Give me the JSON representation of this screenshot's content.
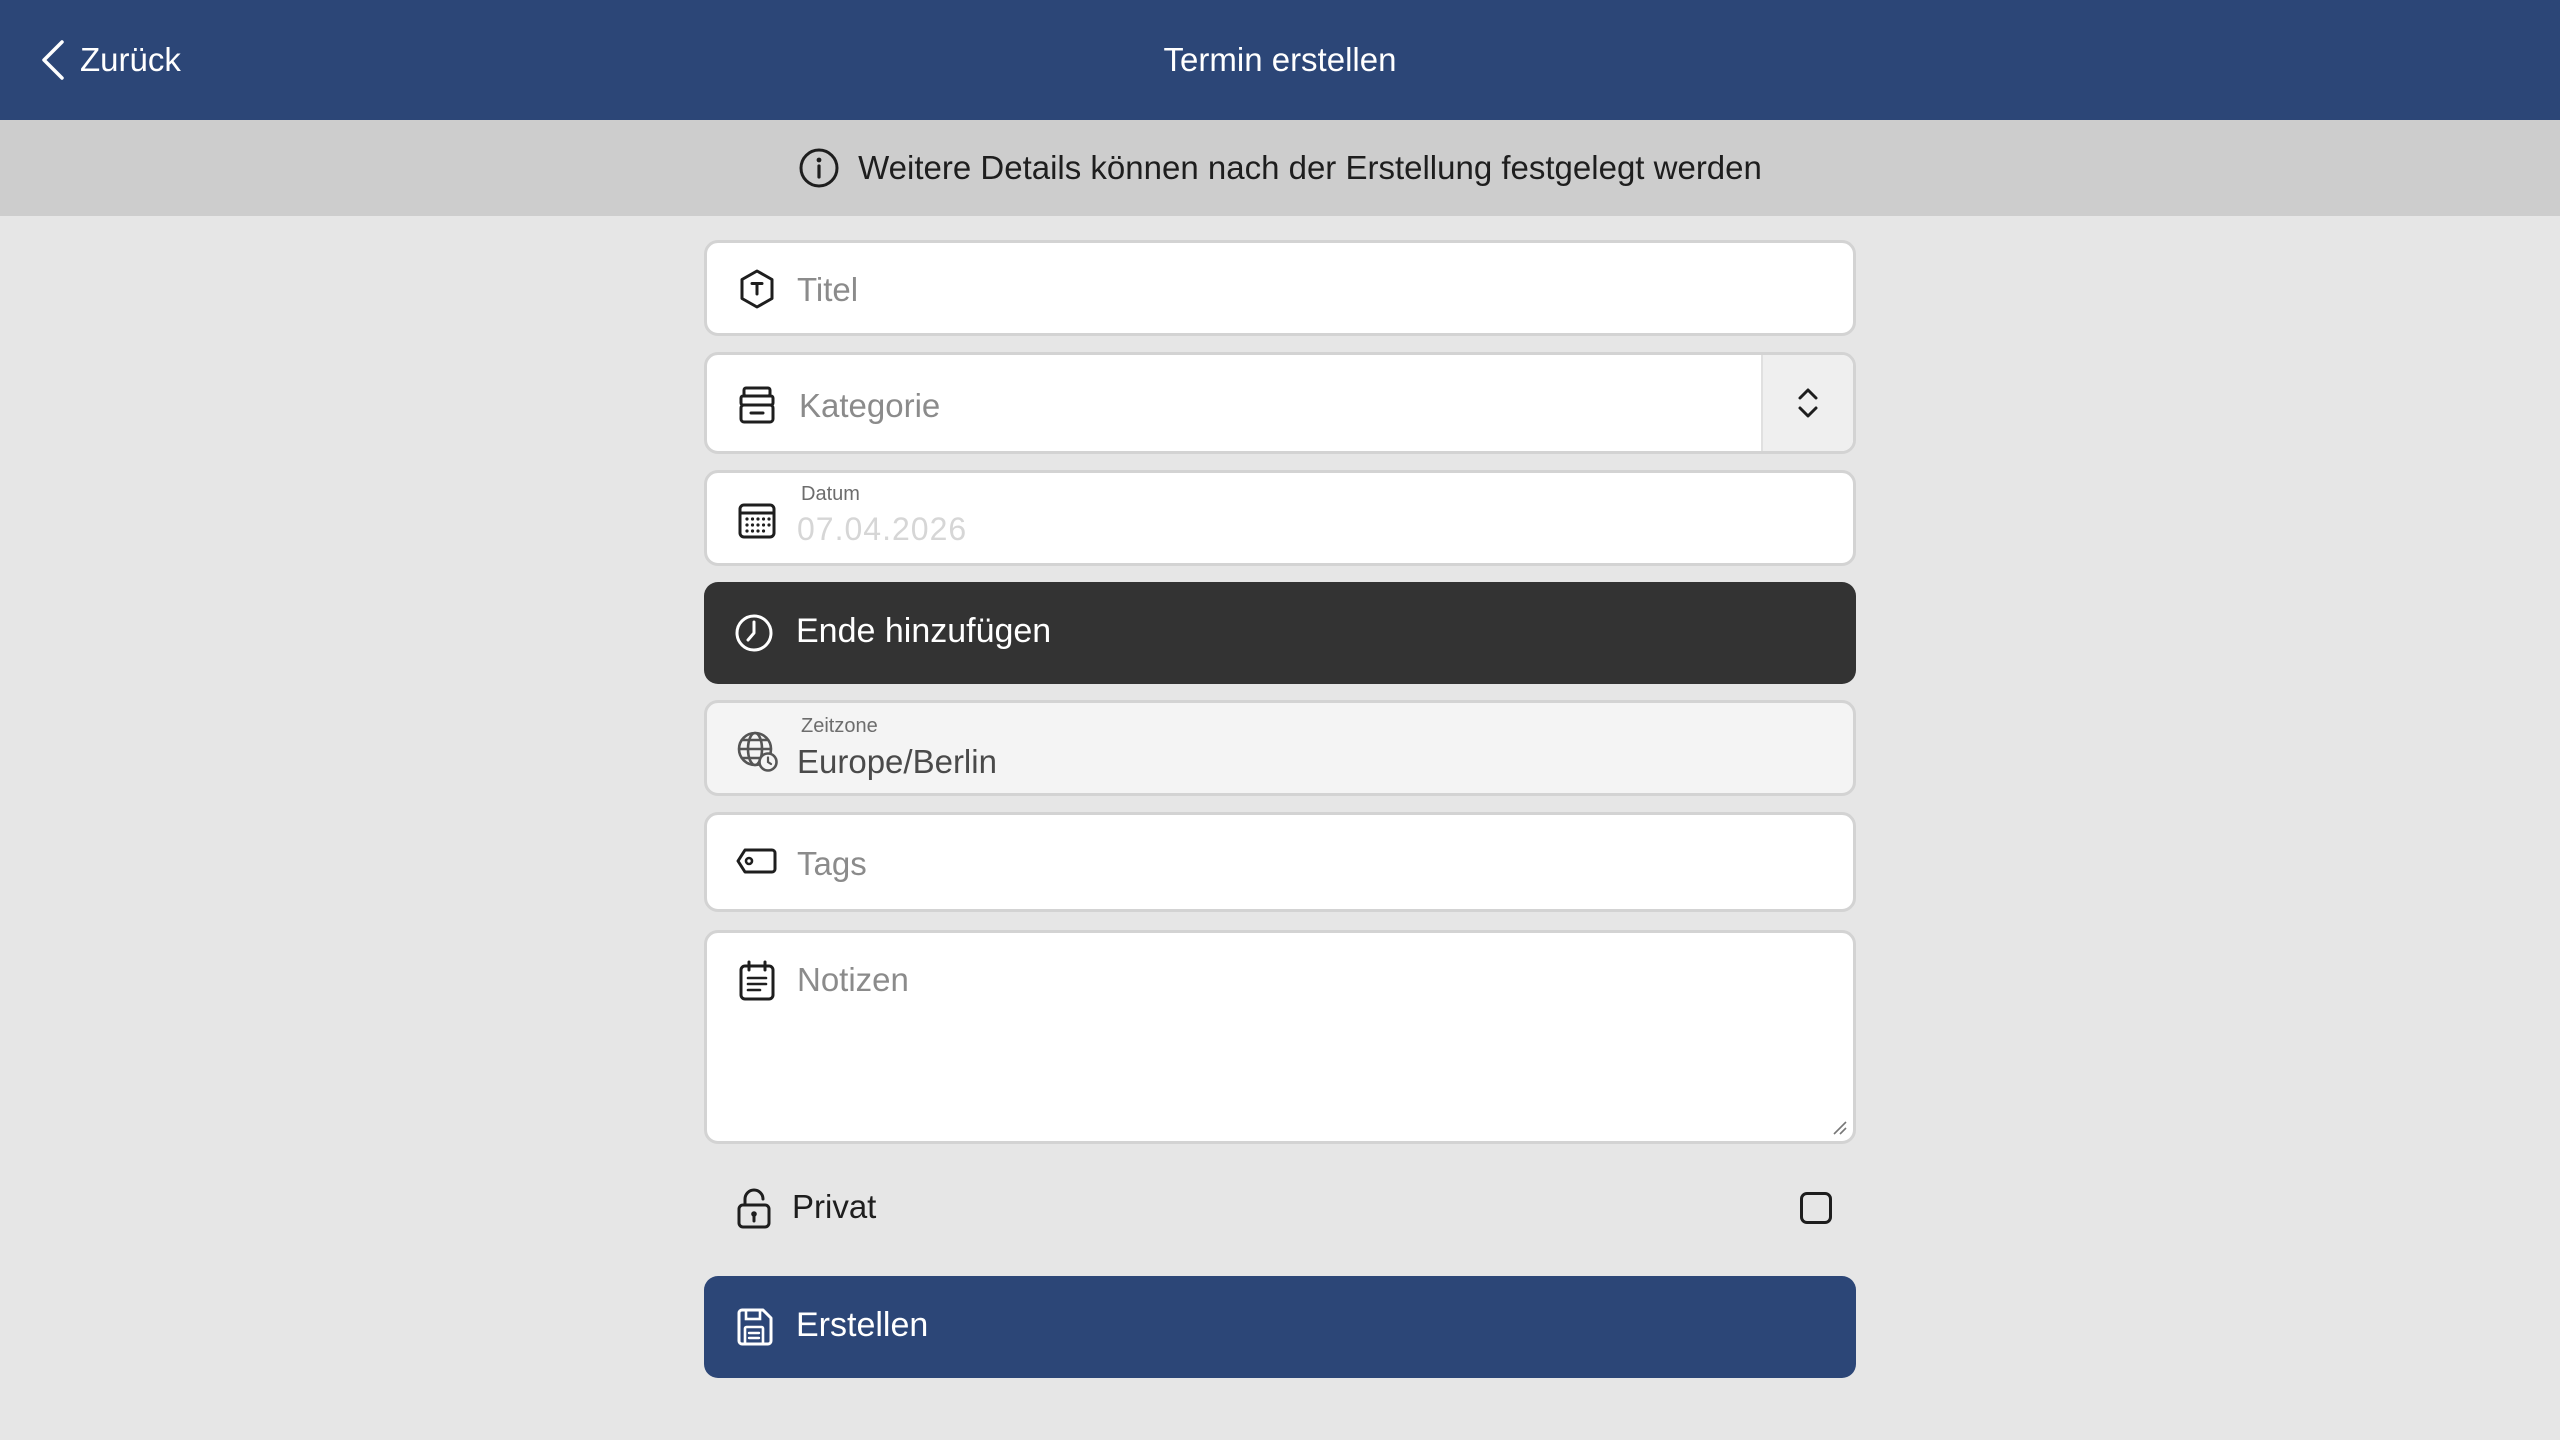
{
  "header": {
    "back_label": "Zurück",
    "title": "Termin erstellen",
    "background": "#2c4677"
  },
  "info": {
    "text": "Weitere Details können nach der Erstellung festgelegt werden",
    "icon": "info-icon"
  },
  "form": {
    "title": {
      "placeholder": "Titel",
      "icon": "title-tag-icon"
    },
    "category": {
      "placeholder": "Kategorie",
      "icon": "archive-box-icon",
      "stepper_icon": "chevron-up-down-icon"
    },
    "date": {
      "label": "Datum",
      "value": "07.04.2026",
      "icon": "calendar-icon"
    },
    "add_end": {
      "label": "Ende hinzufügen",
      "icon": "clock-icon",
      "background": "#333333"
    },
    "timezone": {
      "label": "Zeitzone",
      "value": "Europe/Berlin",
      "icon": "globe-clock-icon"
    },
    "tags": {
      "placeholder": "Tags",
      "icon": "tag-icon"
    },
    "notes": {
      "placeholder": "Notizen",
      "icon": "notes-calendar-icon"
    },
    "private": {
      "label": "Privat",
      "checked": false,
      "icon": "lock-icon"
    },
    "submit": {
      "label": "Erstellen",
      "icon": "save-icon",
      "background": "#2c4677"
    }
  }
}
